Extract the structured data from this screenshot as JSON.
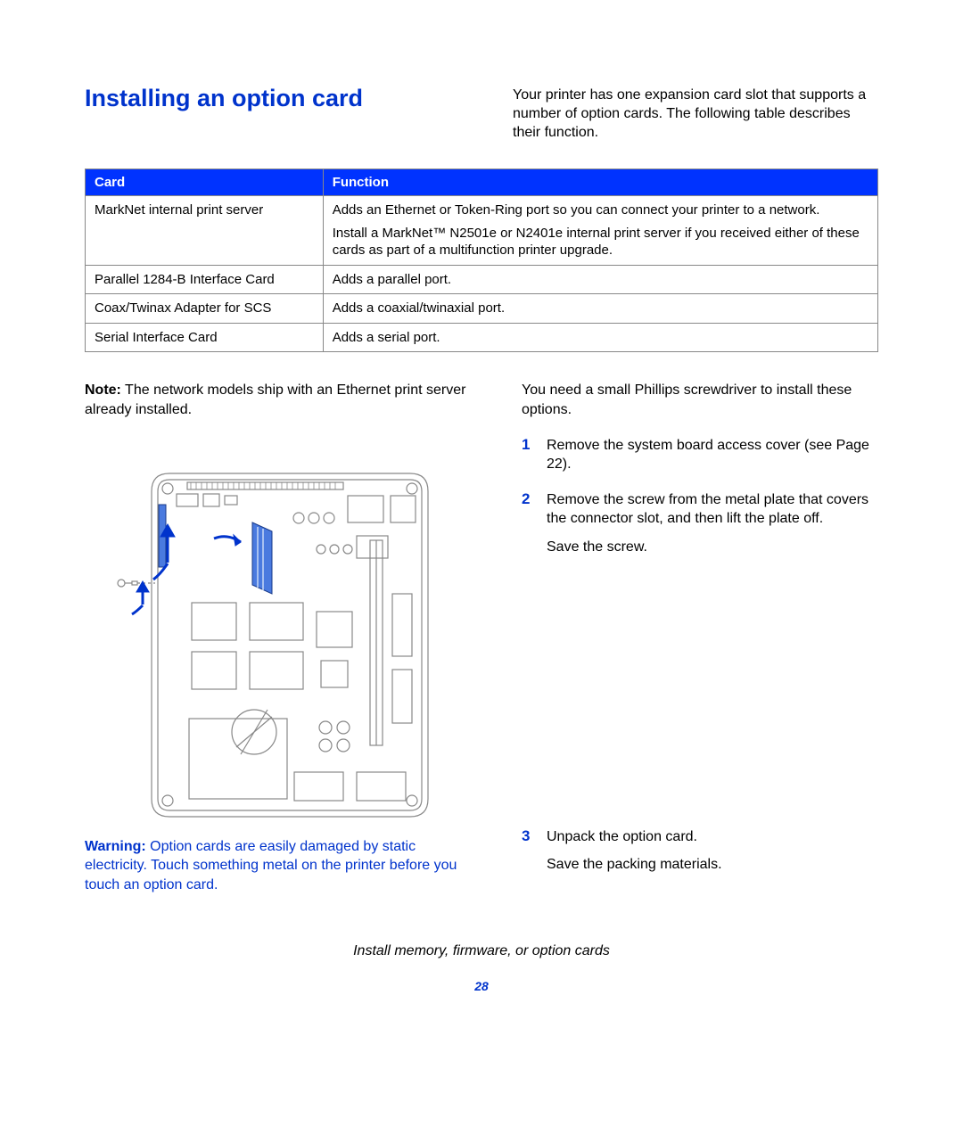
{
  "heading": "Installing an option card",
  "intro": "Your printer has one expansion card slot that supports a number of option cards. The following table describes their function.",
  "table": {
    "headers": {
      "card": "Card",
      "function": "Function"
    },
    "rows": [
      {
        "card": "MarkNet internal print server",
        "function_paras": [
          "Adds an Ethernet or Token-Ring port so you can connect your printer to a network.",
          "Install a MarkNet™ N2501e or N2401e internal print server if you received either of these cards as part of a multifunction printer upgrade."
        ]
      },
      {
        "card": "Parallel 1284-B Interface Card",
        "function_paras": [
          "Adds a parallel port."
        ]
      },
      {
        "card": "Coax/Twinax Adapter for SCS",
        "function_paras": [
          "Adds a coaxial/twinaxial port."
        ]
      },
      {
        "card": "Serial Interface Card",
        "function_paras": [
          "Adds a serial port."
        ]
      }
    ]
  },
  "note": {
    "label": "Note:",
    "text": " The network models ship with an Ethernet print server already installed."
  },
  "warning": {
    "label": "Warning:",
    "text": " Option cards are easily damaged by static electricity. Touch something metal on the printer before you touch an option card."
  },
  "right_intro": "You need a small Phillips screwdriver to install these options.",
  "steps": [
    {
      "num": "1",
      "body": "Remove the system board access cover (see Page 22).",
      "sub": ""
    },
    {
      "num": "2",
      "body": "Remove the screw from the metal plate that covers the connector slot, and then lift the plate off.",
      "sub": "Save the screw."
    },
    {
      "num": "3",
      "body": "Unpack the option card.",
      "sub": "Save the packing materials."
    }
  ],
  "footer": {
    "title": "Install memory, firmware, or option cards",
    "page": "28"
  }
}
